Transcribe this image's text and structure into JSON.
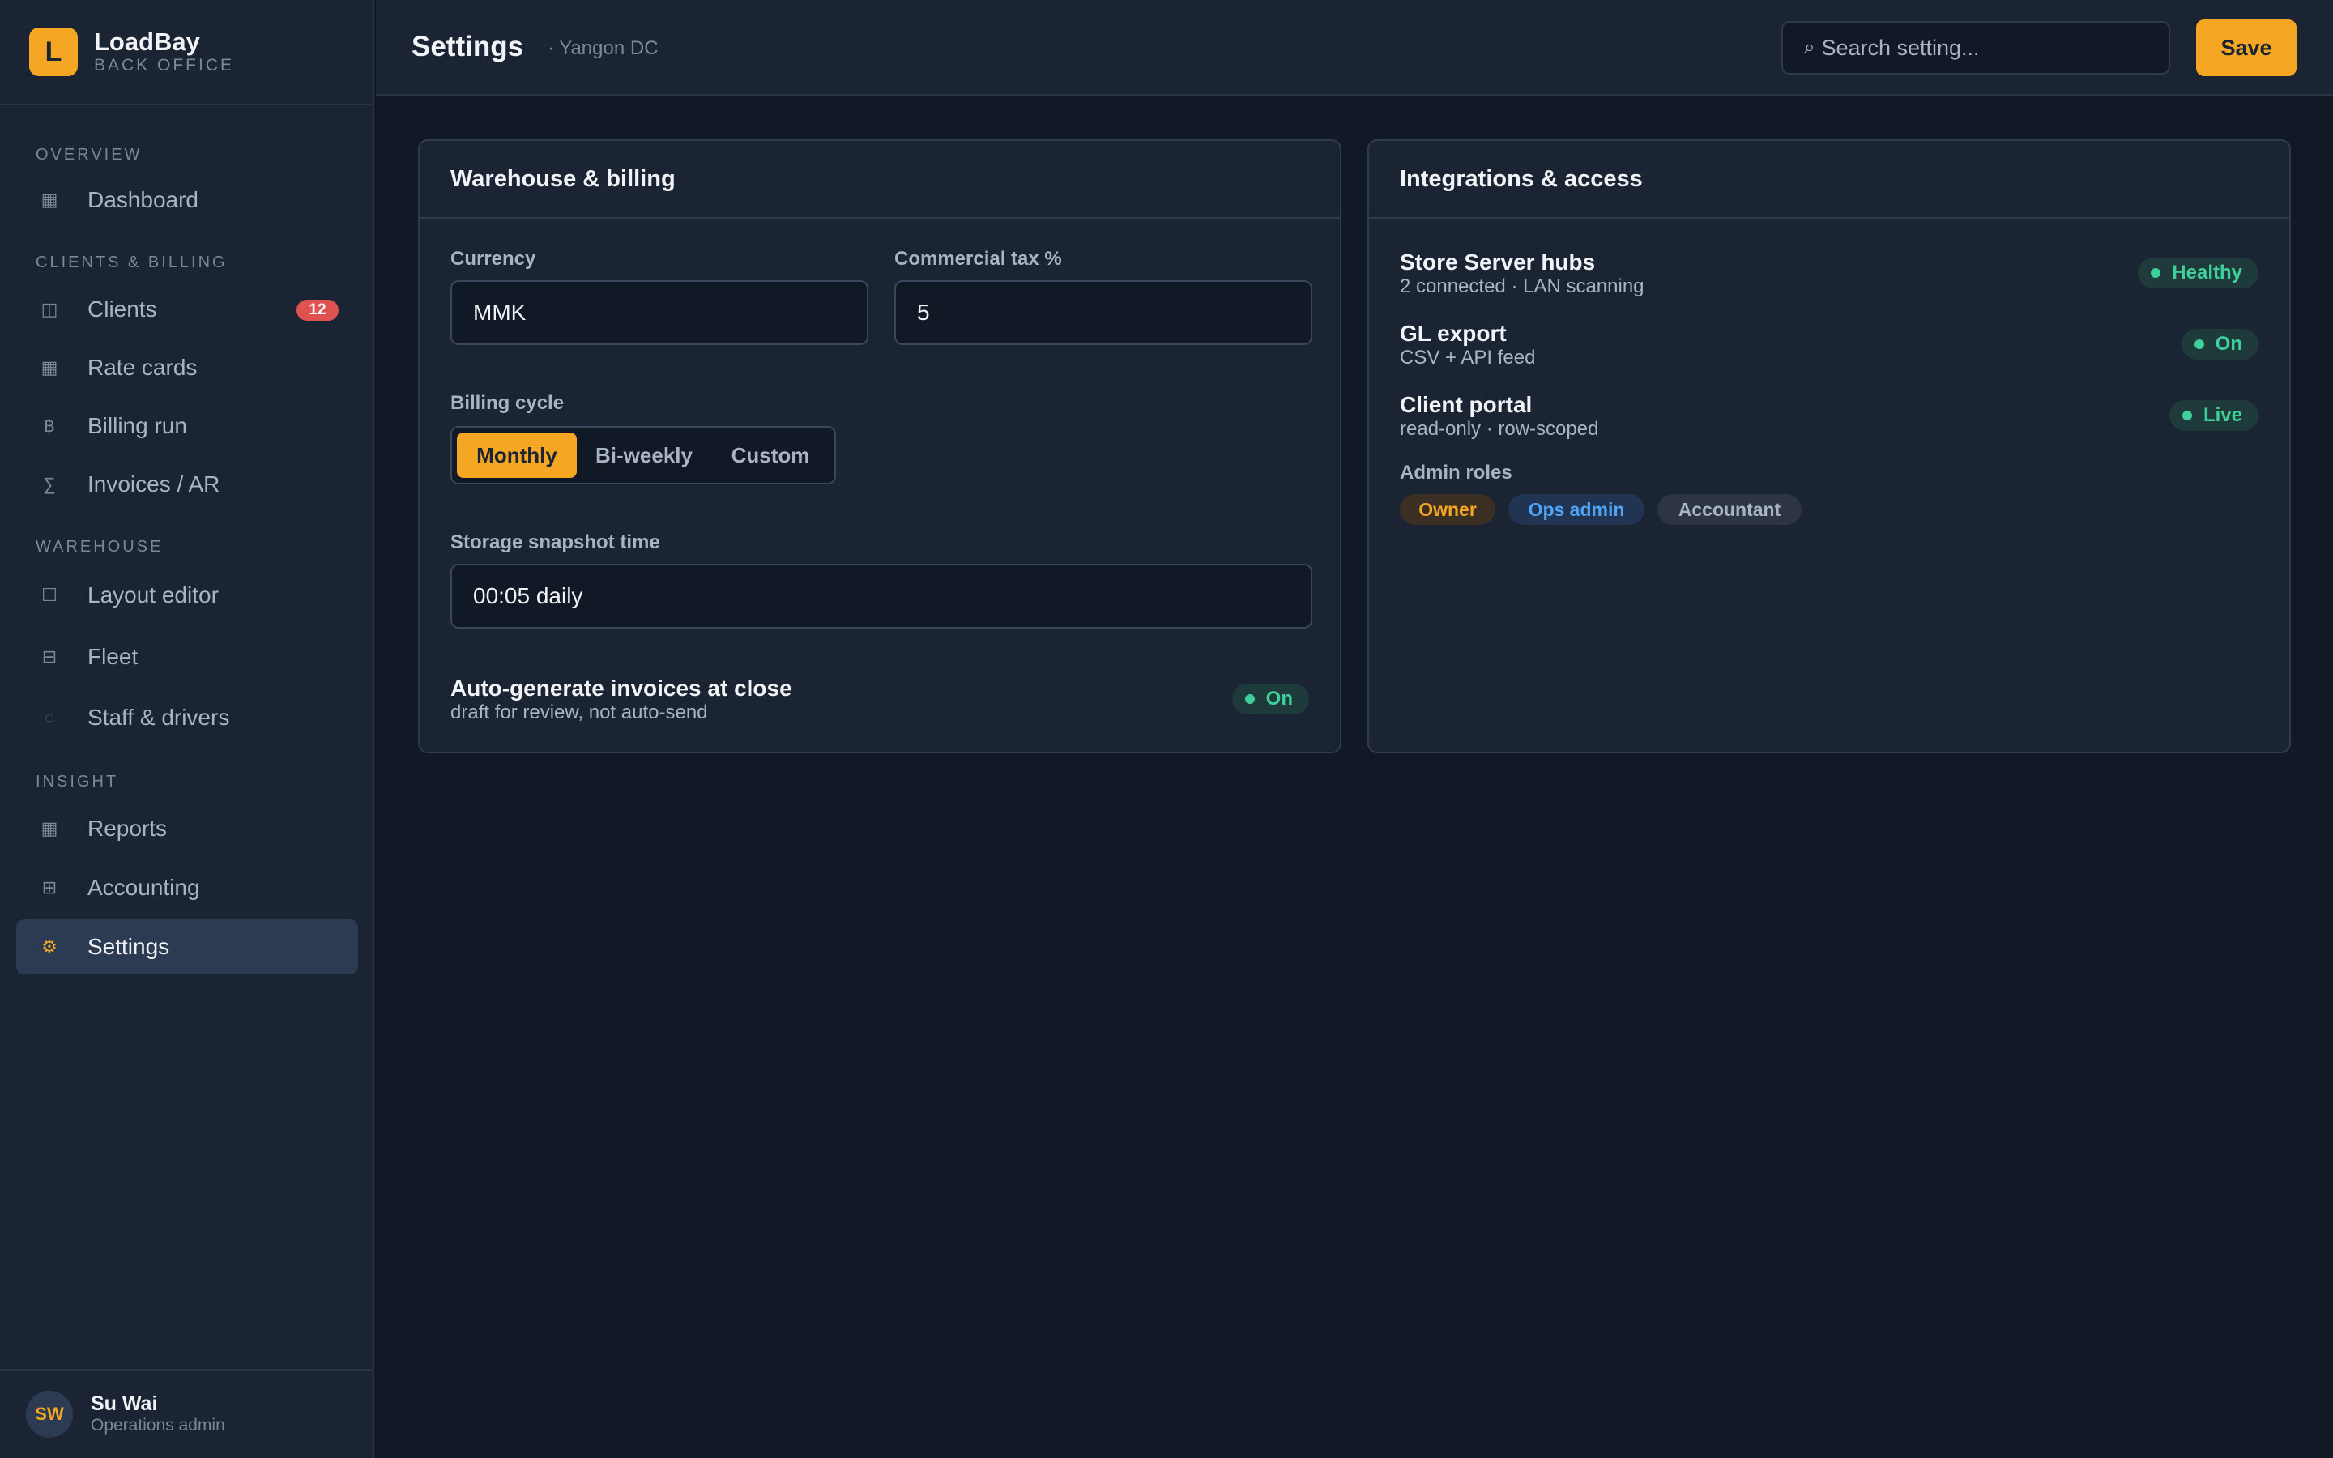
{
  "brand": {
    "logo_letter": "L",
    "name": "LoadBay",
    "subtitle": "BACK OFFICE"
  },
  "sidebar": {
    "sections": {
      "overview": "OVERVIEW",
      "clients_billing": "CLIENTS & BILLING",
      "warehouse": "WAREHOUSE",
      "insight": "INSIGHT"
    },
    "items": {
      "dashboard": {
        "label": "Dashboard",
        "icon": "square-icon",
        "glyph": "▦"
      },
      "clients": {
        "label": "Clients",
        "icon": "columns-icon",
        "glyph": "◫",
        "badge": "12"
      },
      "rate_cards": {
        "label": "Rate cards",
        "icon": "square-icon",
        "glyph": "▦"
      },
      "billing_run": {
        "label": "Billing run",
        "icon": "baht-icon",
        "glyph": "฿"
      },
      "invoices": {
        "label": "Invoices / AR",
        "icon": "sigma-icon",
        "glyph": "∑"
      },
      "layout_editor": {
        "label": "Layout editor",
        "icon": "outline-square-icon",
        "glyph": "☐"
      },
      "fleet": {
        "label": "Fleet",
        "icon": "split-square-icon",
        "glyph": "⊟"
      },
      "staff": {
        "label": "Staff & drivers",
        "icon": "circle-icon",
        "glyph": "○"
      },
      "reports": {
        "label": "Reports",
        "icon": "square-icon",
        "glyph": "▦"
      },
      "accounting": {
        "label": "Accounting",
        "icon": "grid-icon",
        "glyph": "⊞"
      },
      "settings": {
        "label": "Settings",
        "icon": "gear-icon",
        "glyph": "⚙"
      }
    }
  },
  "user": {
    "initials": "SW",
    "name": "Su Wai",
    "role": "Operations admin"
  },
  "header": {
    "title": "Settings",
    "subtitle": "· Yangon DC",
    "search_placeholder": "Search setting...",
    "search_glyph": "⌕",
    "save_label": "Save"
  },
  "warehouse_card": {
    "title": "Warehouse & billing",
    "currency_label": "Currency",
    "currency_value": "MMK",
    "tax_label": "Commercial tax %",
    "tax_value": "5",
    "cycle_label": "Billing cycle",
    "cycle_options": [
      "Monthly",
      "Bi-weekly",
      "Custom"
    ],
    "cycle_selected": "Monthly",
    "snapshot_label": "Storage snapshot time",
    "snapshot_value": "00:05 daily",
    "auto_title": "Auto-generate invoices at close",
    "auto_desc": "draft for review, not auto-send",
    "auto_status": "On"
  },
  "integrations_card": {
    "title": "Integrations & access",
    "rows": [
      {
        "title": "Store Server hubs",
        "desc": "2 connected · LAN scanning",
        "status": "Healthy"
      },
      {
        "title": "GL export",
        "desc": "CSV + API feed",
        "status": "On"
      },
      {
        "title": "Client portal",
        "desc": "read-only · row-scoped",
        "status": "Live"
      }
    ],
    "roles_label": "Admin roles",
    "roles": [
      "Owner",
      "Ops admin",
      "Accountant"
    ]
  },
  "colors": {
    "accent": "#f5a623",
    "success": "#3fcf9a",
    "danger": "#e05252",
    "info": "#4ea3f5",
    "background": "#111826",
    "surface": "#1b2433"
  }
}
